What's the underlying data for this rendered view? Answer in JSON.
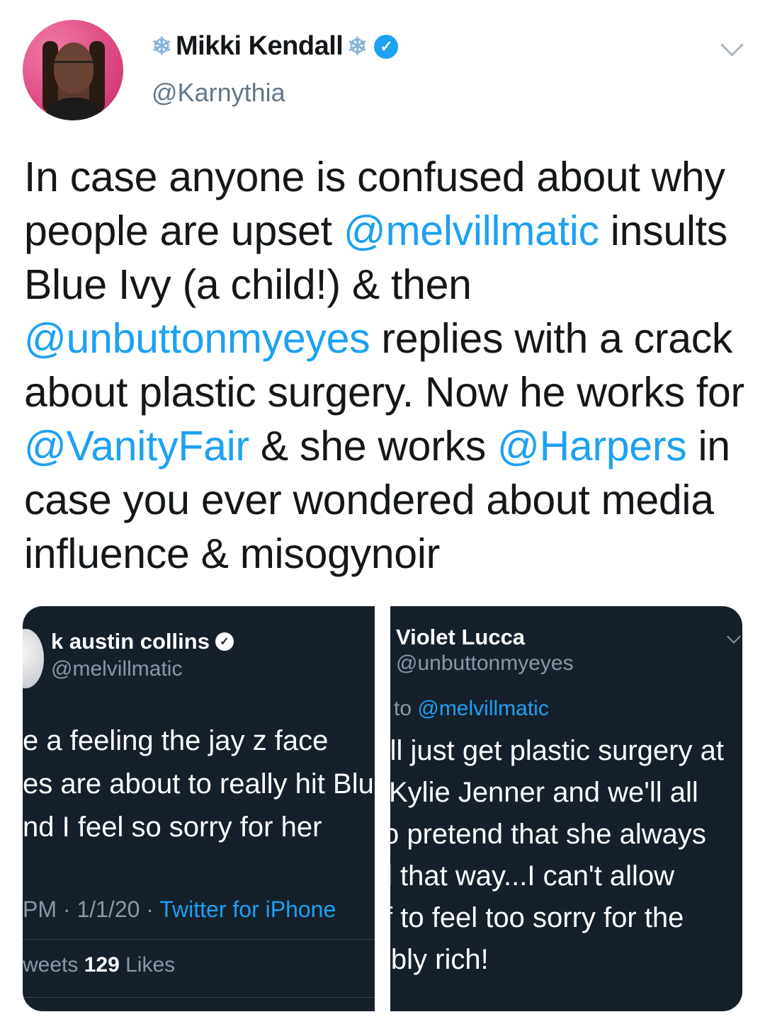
{
  "author": {
    "name": "Mikki Kendall",
    "handle": "@Karnythia",
    "snowflake": "❄",
    "verified_mark": "✓",
    "avatar_icon": "profile-photo",
    "menu_icon": "chevron-down-icon"
  },
  "tweet": {
    "parts": [
      {
        "t": "In case anyone is confused about why people are upset ",
        "mention": false
      },
      {
        "t": "@melvillmatic",
        "mention": true
      },
      {
        "t": " insults Blue Ivy (a child!) & then ",
        "mention": false
      },
      {
        "t": "@unbuttonmyeyes",
        "mention": true
      },
      {
        "t": " replies with a crack about plastic surgery. Now he works for ",
        "mention": false
      },
      {
        "t": "@VanityFair",
        "mention": true
      },
      {
        "t": " & she works ",
        "mention": false
      },
      {
        "t": "@Harpers",
        "mention": true
      },
      {
        "t": " in case you ever wondered about media influence & misogynoir",
        "mention": false
      }
    ]
  },
  "left_card": {
    "name": "k austin collins",
    "handle": "@melvillmatic",
    "verified_mark": "✓",
    "lines": [
      "e a feeling the jay z face",
      "es are about to really hit Blue",
      "nd I feel so sorry for her"
    ],
    "meta_prefix": "PM · 1/1/20 · ",
    "meta_source": "Twitter for iPhone",
    "stats_prefix": "weets  ",
    "likes_count": "129",
    "likes_label": " Likes"
  },
  "right_card": {
    "name": "Violet Lucca",
    "handle": "@unbuttonmyeyes",
    "reply_prefix": "j to ",
    "reply_mention": "@melvillmatic",
    "lines": [
      "'ll just get plastic surgery at",
      " Kylie Jenner and we'll all",
      "o pretend that she always",
      "l that way...I can't allow",
      "f to feel too sorry for the",
      "ibly rich!"
    ]
  },
  "colors": {
    "mention": "#1da1f2",
    "card_bg": "#15202b",
    "verified": "#1da1f2"
  }
}
